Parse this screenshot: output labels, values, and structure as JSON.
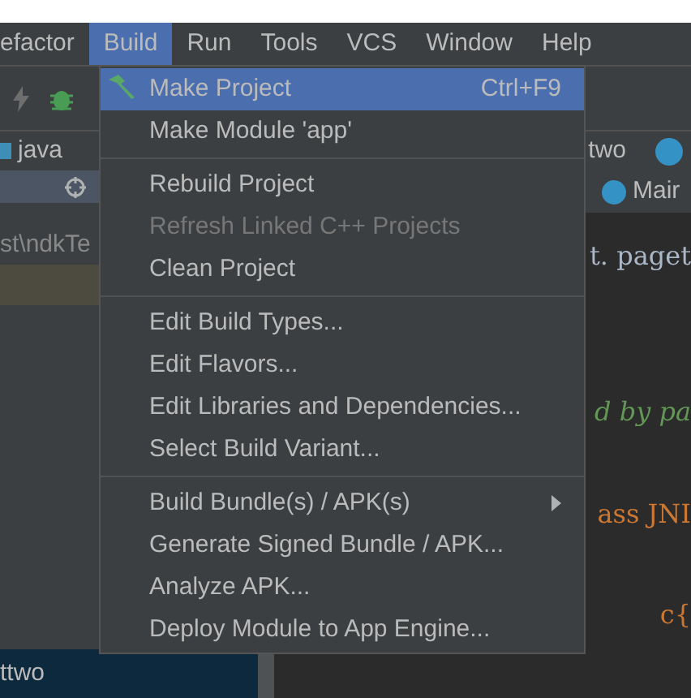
{
  "menu_bar": [
    {
      "label": "efactor",
      "selected": false
    },
    {
      "label": "Build",
      "selected": true
    },
    {
      "label": "Run",
      "selected": false
    },
    {
      "label": "Tools",
      "selected": false
    },
    {
      "label": "VCS",
      "selected": false
    },
    {
      "label": "Window",
      "selected": false
    },
    {
      "label": "Help",
      "selected": false
    }
  ],
  "breadcrumb": {
    "left": "java",
    "right": "two"
  },
  "editor_tab": {
    "label": "Mair"
  },
  "project_panel": {
    "path": "st\\ndkTe",
    "selected_item": "ttwo"
  },
  "editor_code": [
    {
      "text": "t. paget",
      "kind": "plain"
    },
    {
      "text": "d by pa",
      "kind": "comment"
    },
    {
      "text": "ass JNI",
      "kind": "keyword"
    },
    {
      "text": "c{",
      "kind": "keyword"
    }
  ],
  "build_menu": {
    "items": [
      {
        "kind": "item",
        "label": "Make Project",
        "shortcut": "Ctrl+F9",
        "selected": true,
        "disabled": false
      },
      {
        "kind": "item",
        "label": "Make Module 'app'",
        "selected": false,
        "disabled": false
      },
      {
        "kind": "separator"
      },
      {
        "kind": "item",
        "label": "Rebuild Project",
        "selected": false,
        "disabled": false
      },
      {
        "kind": "item",
        "label": "Refresh Linked C++ Projects",
        "selected": false,
        "disabled": true
      },
      {
        "kind": "item",
        "label": "Clean Project",
        "selected": false,
        "disabled": false
      },
      {
        "kind": "separator"
      },
      {
        "kind": "item",
        "label": "Edit Build Types...",
        "selected": false,
        "disabled": false
      },
      {
        "kind": "item",
        "label": "Edit Flavors...",
        "selected": false,
        "disabled": false
      },
      {
        "kind": "item",
        "label": "Edit Libraries and Dependencies...",
        "selected": false,
        "disabled": false
      },
      {
        "kind": "item",
        "label": "Select Build Variant...",
        "selected": false,
        "disabled": false
      },
      {
        "kind": "separator"
      },
      {
        "kind": "item",
        "label": "Build Bundle(s) / APK(s)",
        "selected": false,
        "disabled": false,
        "submenu": true
      },
      {
        "kind": "item",
        "label": "Generate Signed Bundle / APK...",
        "selected": false,
        "disabled": false
      },
      {
        "kind": "item",
        "label": "Analyze APK...",
        "selected": false,
        "disabled": false
      },
      {
        "kind": "item",
        "label": "Deploy Module to App Engine...",
        "selected": false,
        "disabled": false
      }
    ]
  }
}
